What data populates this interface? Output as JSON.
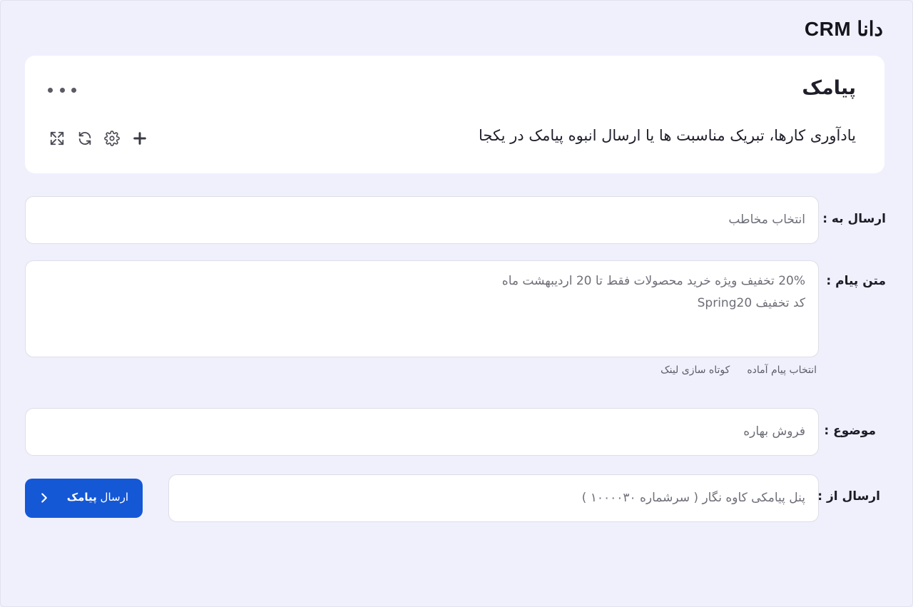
{
  "app": {
    "logo": "CRM دانا"
  },
  "header": {
    "title": "پیامک",
    "subtitle": "یادآوری کارها، تبریک مناسبت ها یا ارسال انبوه پیامک در یکجا",
    "icons": [
      "more-icon",
      "expand-icon",
      "refresh-icon",
      "gear-icon",
      "plus-icon"
    ]
  },
  "form": {
    "send_to": {
      "label": "ارسال به :",
      "placeholder": "انتخاب مخاطب"
    },
    "message": {
      "label": "متن پیام :",
      "lines": [
        "20% تخفیف ویژه خرید محصولات فقط تا 20 اردیبهشت ماه",
        "کد تخفیف Spring20"
      ],
      "links": {
        "ready_message": "انتخاب پیام آماده",
        "shorten_link": "کوتاه سازی لینک"
      }
    },
    "subject": {
      "label": "موضوع :",
      "value": "فروش بهاره"
    },
    "send_from": {
      "label": "ارسال از :",
      "value": "پنل پیامکی کاوه نگار ( سرشماره ۱۰۰۰۰۳۰ )"
    }
  },
  "send_button": {
    "prefix": "ارسال",
    "bold": "پیامک"
  },
  "colors": {
    "background": "#f0f0fd",
    "primary": "#1558d6",
    "card": "#ffffff"
  }
}
